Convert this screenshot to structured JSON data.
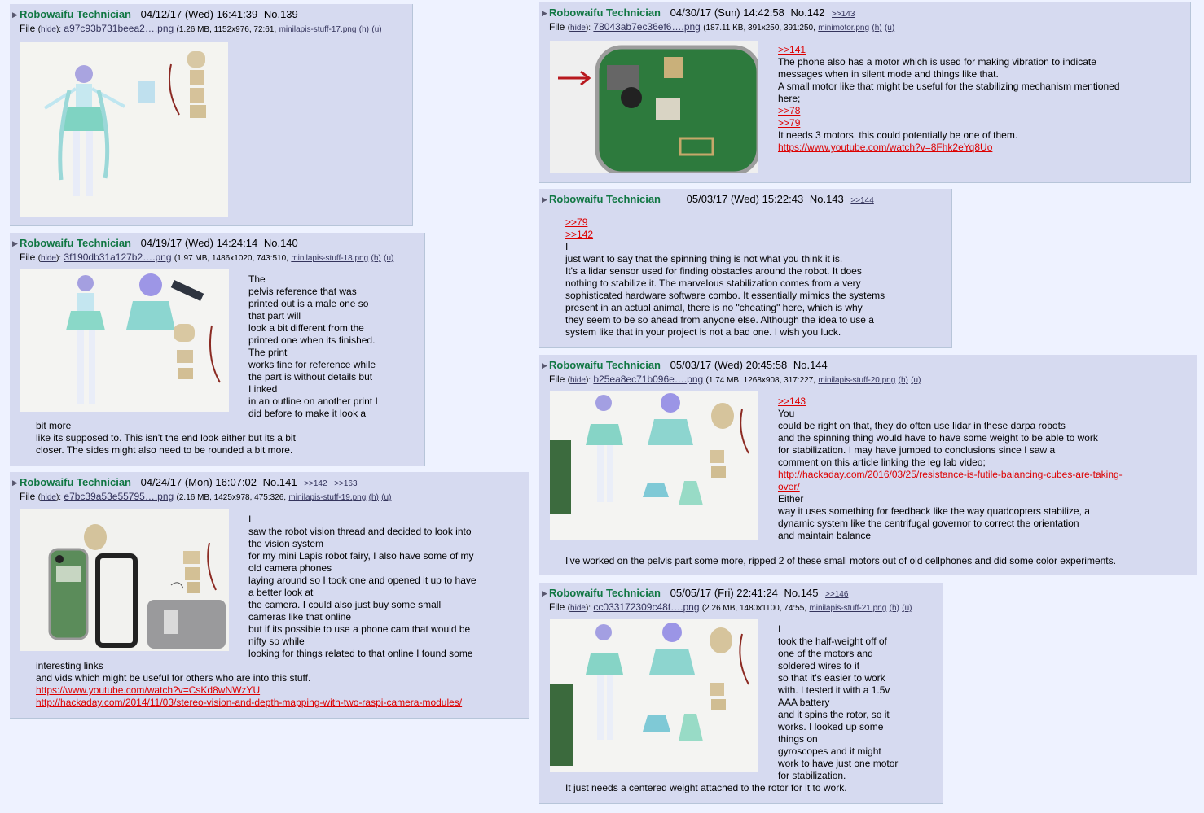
{
  "posts": [
    {
      "name": "Robowaifu Technician",
      "date": "04/12/17 (Wed) 16:41:39",
      "num": "No.139",
      "backlinks": [],
      "file": {
        "label": "File",
        "hide": "hide",
        "name": "a97c93b731beea2….png",
        "meta": "(1.26 MB, 1152x976, 72:61,",
        "orig": "minilapis-stuff-17.png",
        "h": "(h)",
        "u": "(u)"
      },
      "lines": []
    },
    {
      "name": "Robowaifu Technician",
      "date": "04/19/17 (Wed) 14:24:14",
      "num": "No.140",
      "backlinks": [],
      "file": {
        "label": "File",
        "hide": "hide",
        "name": "3f190db31a127b2….png",
        "meta": "(1.97 MB, 1486x1020, 743:510,",
        "orig": "minilapis-stuff-18.png",
        "h": "(h)",
        "u": "(u)"
      },
      "lines": [
        "The",
        " pelvis reference that was",
        "printed out is a male one so",
        "that part will",
        "look a bit different from the",
        "printed one when its finished.",
        "The print",
        "works fine for reference while",
        "the part is without details but",
        "I inked",
        "in an outline on another print I",
        "did before to make it look a",
        "bit more",
        "like its supposed to. This isn't the end look either but its a bit",
        "closer. The sides might also need to be rounded a bit more."
      ]
    },
    {
      "name": "Robowaifu Technician",
      "date": "04/24/17 (Mon) 16:07:02",
      "num": "No.141",
      "backlinks": [
        ">>142",
        ">>163"
      ],
      "file": {
        "label": "File",
        "hide": "hide",
        "name": "e7bc39a53e55795….png",
        "meta": "(2.16 MB, 1425x978, 475:326,",
        "orig": "minilapis-stuff-19.png",
        "h": "(h)",
        "u": "(u)"
      },
      "lines": [
        "I",
        " saw the robot vision thread and decided to look into",
        "the vision system",
        "for my mini Lapis robot fairy, I also have some of my",
        "old camera phones",
        "laying around so I took one and opened it up to have",
        "a better look at",
        "the camera. I could also just buy some small",
        "cameras like that online",
        "but if its possible to use a phone cam that would be",
        "nifty so while",
        "looking for things related to that online I found some",
        "interesting links",
        " and vids which might be useful for others who are into this stuff.",
        "https://www.youtube.com/watch?v=CsKd8wNWzYU",
        "http://hackaday.com/2014/11/03/stereo-vision-and-depth-mapping-with-two-raspi-camera-modules/"
      ]
    },
    {
      "name": "Robowaifu Technician",
      "date": "04/30/17 (Sun) 14:42:58",
      "num": "No.142",
      "backlinks": [
        ">>143"
      ],
      "file": {
        "label": "File",
        "hide": "hide",
        "name": "78043ab7ec36ef6….png",
        "meta": "(187.11 KB, 391x250, 391:250,",
        "orig": "minimotor.png",
        "h": "(h)",
        "u": "(u)"
      },
      "lines": [
        ">>141",
        "The phone also has a motor which is used for making vibration to indicate",
        "messages when in silent mode and things like that.",
        "A small motor like that might be useful for the stabilizing mechanism mentioned",
        "here;",
        ">>78",
        ">>79",
        "It needs 3 motors, this could potentially be one of them.",
        "https://www.youtube.com/watch?v=8Fhk2eYq8Uo"
      ]
    },
    {
      "name": "Robowaifu Technician",
      "date": "05/03/17 (Wed) 15:22:43",
      "num": "No.143",
      "backlinks": [
        ">>144"
      ],
      "file": null,
      "lines": [
        ">>79",
        ">>142",
        "I",
        " just want to say that the spinning thing is not what you think it is.",
        "It's a lidar sensor used for finding obstacles around the robot. It does",
        " nothing to stabilize it. The marvelous stabilization comes from a very",
        "sophisticated hardware software combo. It essentially mimics the systems",
        " present in an actual animal, there is no \"cheating\" here, which is why",
        "they seem to be so ahead from anyone else. Although the idea to use a",
        "system like that in your project is not a bad one. I wish you luck."
      ]
    },
    {
      "name": "Robowaifu Technician",
      "date": "05/03/17 (Wed) 20:45:58",
      "num": "No.144",
      "backlinks": [],
      "file": {
        "label": "File",
        "hide": "hide",
        "name": "b25ea8ec71b096e….png",
        "meta": "(1.74 MB, 1268x908, 317:227,",
        "orig": "minilapis-stuff-20.png",
        "h": "(h)",
        "u": "(u)"
      },
      "lines": [
        ">>143",
        "You",
        " could be right on that, they do often use lidar in these darpa robots",
        "and the spinning thing would have to have some weight to be able to work",
        " for stabilization. I may have jumped to conclusions since I saw a",
        "comment on this article linking the leg lab video;",
        "http://hackaday.com/2016/03/25/resistance-is-futile-balancing-cubes-are-taking-",
        "over/",
        "Either",
        " way it uses something for feedback like the way quadcopters stabilize, a",
        " dynamic system like the centrifugal governor to correct the orientation",
        " and maintain balance",
        "I've worked on the pelvis part some more, ripped 2 of these small motors out of old cellphones and did some color experiments."
      ]
    },
    {
      "name": "Robowaifu Technician",
      "date": "05/05/17 (Fri) 22:41:24",
      "num": "No.145",
      "backlinks": [
        ">>146"
      ],
      "file": {
        "label": "File",
        "hide": "hide",
        "name": "cc033172309c48f….png",
        "meta": "(2.26 MB, 1480x1100, 74:55,",
        "orig": "minilapis-stuff-21.png",
        "h": "(h)",
        "u": "(u)"
      },
      "lines": [
        "I",
        " took the half-weight off of",
        "one of the motors and",
        "soldered wires to it",
        "so that it's easier to work",
        "with. I tested it with a 1.5v",
        "AAA battery",
        "and it spins the rotor, so it",
        "works. I looked up some",
        "things on",
        "gyroscopes and it might",
        "work to have just one motor",
        "for stabilization.",
        "It just needs a centered weight attached to the rotor for it to work."
      ]
    }
  ]
}
